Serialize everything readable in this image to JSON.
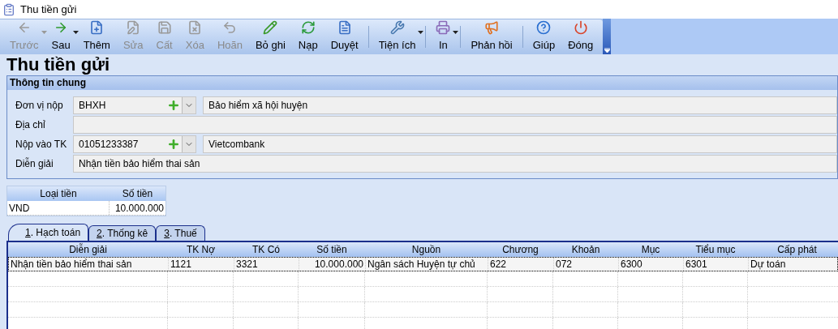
{
  "window": {
    "title": "Thu tiền gửi"
  },
  "toolbar": [
    {
      "kind": "button",
      "label": "Trước",
      "disabled": true,
      "dropdown": true
    },
    {
      "kind": "button",
      "label": "Sau",
      "disabled": false,
      "dropdown": true
    },
    {
      "kind": "button",
      "label": "Thêm",
      "disabled": false,
      "dropdown": false
    },
    {
      "kind": "button",
      "label": "Sửa",
      "disabled": true,
      "dropdown": false
    },
    {
      "kind": "button",
      "label": "Cất",
      "disabled": true,
      "dropdown": false
    },
    {
      "kind": "button",
      "label": "Xóa",
      "disabled": true,
      "dropdown": false
    },
    {
      "kind": "button",
      "label": "Hoãn",
      "disabled": true,
      "dropdown": false
    },
    {
      "kind": "button",
      "label": "Bỏ ghi",
      "disabled": false,
      "dropdown": false
    },
    {
      "kind": "button",
      "label": "Nạp",
      "disabled": false,
      "dropdown": false
    },
    {
      "kind": "button",
      "label": "Duyệt",
      "disabled": false,
      "dropdown": false
    },
    {
      "kind": "separator"
    },
    {
      "kind": "button",
      "label": "Tiện ích",
      "disabled": false,
      "dropdown": true
    },
    {
      "kind": "separator"
    },
    {
      "kind": "button",
      "label": "In",
      "disabled": false,
      "dropdown": true
    },
    {
      "kind": "separator"
    },
    {
      "kind": "button",
      "label": "Phản hồi",
      "disabled": false,
      "dropdown": false
    },
    {
      "kind": "separator"
    },
    {
      "kind": "button",
      "label": "Giúp",
      "disabled": false,
      "dropdown": false
    },
    {
      "kind": "button",
      "label": "Đóng",
      "disabled": false,
      "dropdown": false
    }
  ],
  "heading": "Thu tiền gửi",
  "general_info": {
    "title": "Thông tin chung",
    "fields": [
      {
        "kind": "lookup",
        "label": "Đơn vị nộp",
        "value": "BHXH",
        "name_value": "Bảo hiểm xã hội huyện"
      },
      {
        "kind": "text",
        "label": "Địa chỉ"
      },
      {
        "kind": "lookup",
        "label": "Nộp vào TK",
        "value": "01051233387",
        "name_value": "Vietcombank"
      },
      {
        "kind": "text",
        "label": "Diễn giải",
        "value": "Nhận tiền bảo hiểm thai sản"
      }
    ]
  },
  "currency_table": {
    "columns": [
      "Loại tiền",
      "Số tiền"
    ],
    "rows": [
      [
        "VND",
        "10.000.000"
      ]
    ]
  },
  "tabs": [
    {
      "label": "1. Hạch toán",
      "selected": true
    },
    {
      "label": "2. Thống kê",
      "selected": false
    },
    {
      "label": "3. Thuế",
      "selected": false
    }
  ],
  "entries_table": {
    "columns": [
      "Diễn giải",
      "TK Nợ",
      "TK Có",
      "Số tiền",
      "Nguồn",
      "Chương",
      "Khoản",
      "Mục",
      "Tiểu mục",
      "Cấp phát"
    ],
    "rows": [
      {
        "selected": true,
        "cells": [
          "Nhận tiền bảo hiểm thai sản",
          "1121",
          "3321",
          "10.000.000",
          "Ngân sách Huyện tự chủ",
          "622",
          "072",
          "6300",
          "6301",
          "Dự toán"
        ]
      }
    ]
  }
}
